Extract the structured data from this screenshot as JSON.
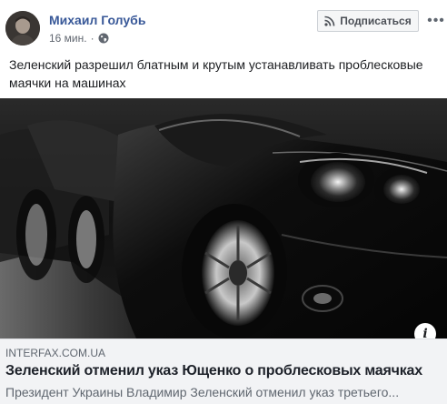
{
  "post": {
    "author_name": "Михаил Голубь",
    "timestamp": "16 мин.",
    "privacy_icon": "globe-icon",
    "subscribe_label": "Подписаться",
    "subscribe_icon": "rss-icon",
    "menu_icon": "more-icon",
    "text": "Зеленский разрешил блатным и крутым устанавливать проблесковые маячки на машинах"
  },
  "link_preview": {
    "image_description_icon": "car-photo",
    "info_icon": "info-icon",
    "domain": "INTERFAX.COM.UA",
    "title": "Зеленский отменил указ Ющенко о проблесковых маячках",
    "description": "Президент Украины Владимир Зеленский отменил указ третьего..."
  },
  "colors": {
    "author": "#385898",
    "meta": "#616770",
    "link_bg": "#f2f3f5"
  }
}
